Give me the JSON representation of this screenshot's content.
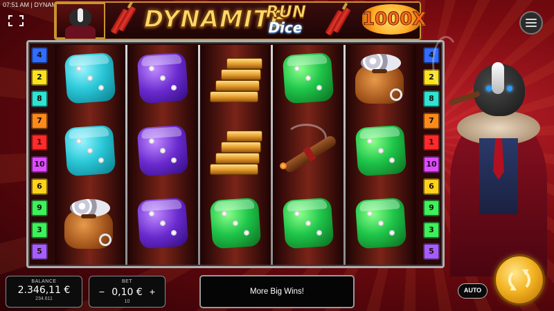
{
  "status_bar": {
    "time": "07:51 AM",
    "separator": "|",
    "game_id": "DYNAMITE RUN DICE"
  },
  "header": {
    "title_main": "DYNAMITE",
    "title_run": "RUN",
    "title_dice": "Dice",
    "max_multiplier": "1000X"
  },
  "paylines": {
    "left": [
      {
        "n": "4",
        "color": "#2f6cff"
      },
      {
        "n": "2",
        "color": "#ffe21a"
      },
      {
        "n": "8",
        "color": "#2fe3d0"
      },
      {
        "n": "7",
        "color": "#ff8a1a"
      },
      {
        "n": "1",
        "color": "#ff2a2a"
      },
      {
        "n": "10",
        "color": "#e04bff"
      },
      {
        "n": "6",
        "color": "#ffd11a"
      },
      {
        "n": "9",
        "color": "#3ff05a"
      },
      {
        "n": "3",
        "color": "#3ff05a"
      },
      {
        "n": "5",
        "color": "#a85cff"
      }
    ],
    "right": [
      {
        "n": "4",
        "color": "#2f6cff"
      },
      {
        "n": "2",
        "color": "#ffe21a"
      },
      {
        "n": "8",
        "color": "#2fe3d0"
      },
      {
        "n": "7",
        "color": "#ff8a1a"
      },
      {
        "n": "1",
        "color": "#ff2a2a"
      },
      {
        "n": "10",
        "color": "#e04bff"
      },
      {
        "n": "6",
        "color": "#ffd11a"
      },
      {
        "n": "9",
        "color": "#3ff05a"
      },
      {
        "n": "3",
        "color": "#3ff05a"
      },
      {
        "n": "5",
        "color": "#a85cff"
      }
    ]
  },
  "reels": [
    [
      "teal-die",
      "teal-die",
      "money-bag"
    ],
    [
      "purple-die",
      "purple-die",
      "purple-die"
    ],
    [
      "gold-bars",
      "gold-bars",
      "green-die"
    ],
    [
      "green-die",
      "cigar",
      "green-die"
    ],
    [
      "money-bag",
      "green-die",
      "green-die"
    ]
  ],
  "controls": {
    "balance_label": "BALANCE",
    "balance_value": "2.346,11 €",
    "balance_sub": "234.611",
    "bet_label": "BET",
    "bet_value": "0,10 €",
    "bet_sub": "10",
    "bet_minus": "−",
    "bet_plus": "+",
    "message": "More Big Wins!",
    "auto_label": "AUTO"
  }
}
